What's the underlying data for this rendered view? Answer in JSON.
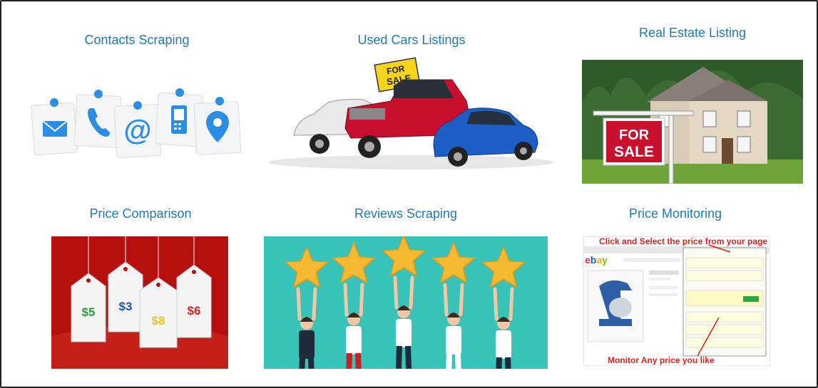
{
  "cards": [
    {
      "title": "Contacts Scraping",
      "image_alt": "Contact icons pinned notes"
    },
    {
      "title": "Used Cars Listings",
      "image_alt": "Cars for sale",
      "sign_line1": "FOR",
      "sign_line2": "SALE"
    },
    {
      "title": "Real Estate Listing",
      "image_alt": "House with for sale sign",
      "sign_line1": "FOR",
      "sign_line2": "SALE"
    },
    {
      "title": "Price Comparison",
      "image_alt": "Price tags",
      "tags": [
        "$5",
        "$3",
        "$8",
        "$6"
      ]
    },
    {
      "title": "Reviews Scraping",
      "image_alt": "People holding stars"
    },
    {
      "title": "Price Monitoring",
      "image_alt": "Price monitoring screenshot",
      "top_caption": "Click and Select the price from your page",
      "bottom_caption": "Monitor Any price you like",
      "logo": "ebay"
    }
  ],
  "colors": {
    "title": "#1f7ab3",
    "icon_blue": "#2b8ee6",
    "sale_red": "#c8102e",
    "reviews_bg": "#37c3b7",
    "price_bg": "#b5100e",
    "star": "#f5b932"
  }
}
